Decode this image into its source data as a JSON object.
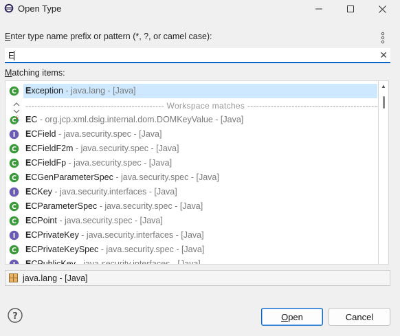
{
  "window": {
    "title": "Open Type"
  },
  "dialog": {
    "prompt_label": "nter type name prefix or pattern (*, ?, or camel case):",
    "prompt_mnemonic": "E",
    "search_value": "E",
    "matching_label": "atching items:",
    "matching_mnemonic": "M"
  },
  "list": {
    "separator": "----------------------------------------------- Workspace matches -----------------------------------------------",
    "rows": [
      {
        "bold": "E",
        "rest": "xception",
        "qual": " - java.lang - [Java]",
        "icon": "class-icon"
      },
      {
        "bold": "E",
        "rest": "C",
        "qual": " - org.jcp.xml.dsig.internal.dom.DOMKeyValue - [Java]",
        "icon": "class-static-final-icon"
      },
      {
        "bold": "E",
        "rest": "CField",
        "qual": " - java.security.spec - [Java]",
        "icon": "interface-icon"
      },
      {
        "bold": "E",
        "rest": "CFieldF2m",
        "qual": " - java.security.spec - [Java]",
        "icon": "class-icon"
      },
      {
        "bold": "E",
        "rest": "CFieldFp",
        "qual": " - java.security.spec - [Java]",
        "icon": "class-icon"
      },
      {
        "bold": "E",
        "rest": "CGenParameterSpec",
        "qual": " - java.security.spec - [Java]",
        "icon": "class-icon"
      },
      {
        "bold": "E",
        "rest": "CKey",
        "qual": " - java.security.interfaces - [Java]",
        "icon": "interface-icon"
      },
      {
        "bold": "E",
        "rest": "CParameterSpec",
        "qual": " - java.security.spec - [Java]",
        "icon": "class-icon"
      },
      {
        "bold": "E",
        "rest": "CPoint",
        "qual": " - java.security.spec - [Java]",
        "icon": "class-icon"
      },
      {
        "bold": "E",
        "rest": "CPrivateKey",
        "qual": " - java.security.interfaces - [Java]",
        "icon": "interface-icon"
      },
      {
        "bold": "E",
        "rest": "CPrivateKeySpec",
        "qual": " - java.security.spec - [Java]",
        "icon": "class-icon"
      },
      {
        "bold": "E",
        "rest": "CPublicKey",
        "qual": " - java.security.interfaces - [Java]",
        "icon": "interface-icon"
      }
    ]
  },
  "package_bar": {
    "text": "java.lang - [Java]"
  },
  "buttons": {
    "open_mnemonic": "O",
    "open_rest": "pen",
    "cancel": "Cancel"
  },
  "colors": {
    "accent": "#0b63c4",
    "selection": "#cde8ff",
    "class_icon": "#3a9a3a",
    "interface_icon": "#6a5cb5"
  }
}
